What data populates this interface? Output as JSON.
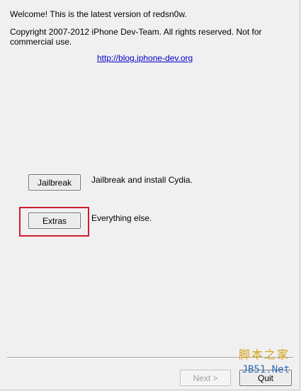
{
  "header": {
    "welcome": "Welcome!  This is the latest version of redsn0w.",
    "copyright": "Copyright 2007-2012 iPhone Dev-Team. All rights reserved. Not for commercial use.",
    "link": "http://blog.iphone-dev.org"
  },
  "actions": {
    "jailbreak": {
      "label": "Jailbreak",
      "description": "Jailbreak and install Cydia."
    },
    "extras": {
      "label": "Extras",
      "description": "Everything else."
    }
  },
  "footer": {
    "next_label": "Next >",
    "quit_label": "Quit"
  },
  "watermark": {
    "line1": "脚本之家",
    "line2": "JB51.Net"
  },
  "colors": {
    "highlight": "#cc1f2e",
    "link": "#0000cc",
    "background": "#f0f0f0"
  }
}
